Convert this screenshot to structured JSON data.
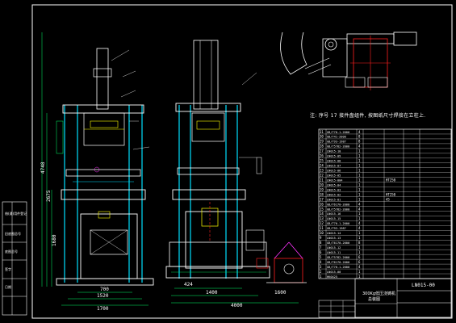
{
  "note_text": "注: 序号 17 接件盘组件, 按图纸尺寸焊接在立柱上.",
  "dims": {
    "height_total": "4748",
    "height_mid": "2675",
    "height_low": "1680",
    "width_700": "700",
    "width_1520": "1520",
    "width_1700": "1700",
    "dim_424": "424",
    "width_1400": "1400",
    "width_4000": "4000",
    "width_1600": "1600"
  },
  "side_labels": [
    "借(通)用件登记",
    "旧底图总号",
    "底图总号",
    "签字",
    "日期"
  ],
  "title_block": {
    "title_line1": "300Kg低压浇铸机",
    "title_line2": "总装图",
    "drawing_no": "LN015-00"
  },
  "bom_rows": [
    {
      "no": "31",
      "code": "GB/T70.1-2000",
      "qty": "4"
    },
    {
      "no": "30",
      "code": "GB/T41-2000",
      "qty": "8"
    },
    {
      "no": "29",
      "code": "GB/T93-1987",
      "qty": "8"
    },
    {
      "no": "28",
      "code": "GB/T5782-2000",
      "qty": "4"
    },
    {
      "no": "27",
      "code": "LN015-10",
      "qty": "1"
    },
    {
      "no": "26",
      "code": "LN015-09",
      "qty": "1"
    },
    {
      "no": "25",
      "code": "LN015-08",
      "qty": "1"
    },
    {
      "no": "24",
      "code": "LN015-07",
      "qty": "1"
    },
    {
      "no": "23",
      "code": "LN015-06",
      "qty": "1"
    },
    {
      "no": "22",
      "code": "LN015-05",
      "qty": "1"
    },
    {
      "no": "21",
      "code": "LN015-004",
      "qty": "1"
    },
    {
      "no": "20",
      "code": "LN015-04",
      "qty": "1"
    },
    {
      "no": "19",
      "code": "LN015-03",
      "qty": "1"
    },
    {
      "no": "18",
      "code": "LN015-02",
      "qty": "1"
    },
    {
      "no": "17",
      "code": "LN015-01",
      "qty": "1"
    },
    {
      "no": "16",
      "code": "GB/T6170-2000",
      "qty": "4"
    },
    {
      "no": "15",
      "code": "GB/T5782-2000",
      "qty": "4"
    },
    {
      "no": "14",
      "code": "LN015-16",
      "qty": "1"
    },
    {
      "no": "13",
      "code": "LN015-15",
      "qty": "1"
    },
    {
      "no": "12",
      "code": "GB/T70.1-2000",
      "qty": "4"
    },
    {
      "no": "11",
      "code": "GB/T93-1987",
      "qty": "4"
    },
    {
      "no": "10",
      "code": "LN015-14",
      "qty": "1"
    },
    {
      "no": "9",
      "code": "LN015-13",
      "qty": "1"
    },
    {
      "no": "8",
      "code": "GB/T6170-2000",
      "qty": "8"
    },
    {
      "no": "7",
      "code": "LN015-12",
      "qty": "1"
    },
    {
      "no": "6",
      "code": "LN015-11",
      "qty": "1"
    },
    {
      "no": "5",
      "code": "GB/T5782-2000",
      "qty": "6"
    },
    {
      "no": "4",
      "code": "GB/T6170-2000",
      "qty": "6"
    },
    {
      "no": "3",
      "code": "GB/T70.1-2000",
      "qty": "4"
    },
    {
      "no": "2",
      "code": "LN015-00",
      "qty": "1"
    },
    {
      "no": "1",
      "code": "HK0425",
      "qty": "1"
    }
  ],
  "bom_materials": {
    "21": "HT250",
    "18": "HT250",
    "17": "45"
  },
  "colors": {
    "line": "#ffffff",
    "frame": "#ffffff",
    "machine": "#00e0ff",
    "detail": "#ffff00",
    "dim": "#00ff66",
    "red": "#ff2020",
    "magenta": "#ff33ff"
  }
}
